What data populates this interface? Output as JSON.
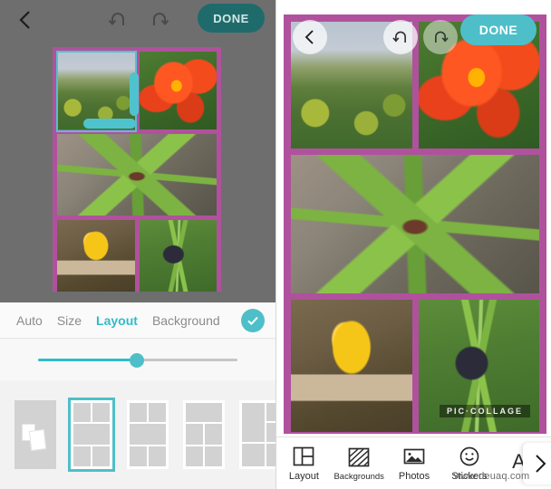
{
  "left_panel": {
    "topbar": {
      "back_icon": "chevron-left-icon",
      "undo_icon": "undo-icon",
      "redo_icon": "redo-icon",
      "done_label": "DONE"
    },
    "collage": {
      "border_color": "#b0519e",
      "selected_cell": "top-left",
      "cells": [
        {
          "name": "green-field-landscape"
        },
        {
          "name": "red-flower"
        },
        {
          "name": "green-fern-leaf"
        },
        {
          "name": "yellow-mushroom"
        },
        {
          "name": "bird-in-grass"
        }
      ]
    },
    "tabs": [
      {
        "label": "Auto",
        "active": false
      },
      {
        "label": "Size",
        "active": false
      },
      {
        "label": "Layout",
        "active": true
      },
      {
        "label": "Background",
        "active": false
      }
    ],
    "confirm_icon": "check-icon",
    "accent_color": "#31bcc8",
    "slider": {
      "value_percent": 47
    },
    "layout_thumbnails": [
      {
        "name": "freeform",
        "selected": false
      },
      {
        "name": "grid-2-1-2",
        "selected": true
      },
      {
        "name": "grid-2-2-2",
        "selected": false
      },
      {
        "name": "grid-1-2-2",
        "selected": false
      },
      {
        "name": "grid-mixed-columns",
        "selected": false
      }
    ]
  },
  "right_panel": {
    "back_icon": "chevron-left-icon",
    "undo_icon": "undo-icon",
    "redo_icon": "redo-icon",
    "done_label": "DONE",
    "collage": {
      "border_color": "#b0519e",
      "cells": [
        {
          "name": "green-field-landscape"
        },
        {
          "name": "red-flower"
        },
        {
          "name": "green-fern-leaf"
        },
        {
          "name": "yellow-mushroom"
        },
        {
          "name": "bird-in-grass"
        }
      ]
    },
    "watermark": "PIC·COLLAGE",
    "bottom_nav": [
      {
        "label": "Layout",
        "icon": "layout-grid-icon"
      },
      {
        "label": "Backgrounds",
        "icon": "diagonal-stripes-icon"
      },
      {
        "label": "Photos",
        "icon": "photo-mountain-icon"
      },
      {
        "label": "Stickers",
        "icon": "smiley-icon"
      },
      {
        "label": "",
        "icon": "text-aa-icon"
      }
    ],
    "text_tool_label": "Aa",
    "next_icon": "chevron-right-icon",
    "accent_color": "#4ebfc9"
  },
  "overlay_watermark": "www.deuaq.com"
}
